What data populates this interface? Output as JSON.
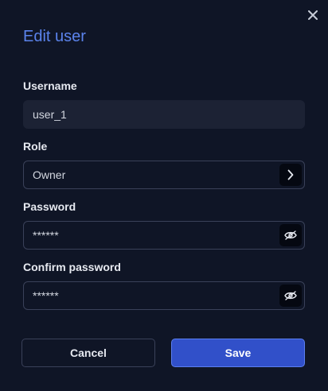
{
  "dialog": {
    "title": "Edit user",
    "close_icon": "close-icon"
  },
  "form": {
    "username": {
      "label": "Username",
      "value": "user_1"
    },
    "role": {
      "label": "Role",
      "value": "Owner",
      "icon": "chevron-right-icon"
    },
    "password": {
      "label": "Password",
      "value": "******",
      "icon": "eye-slash-icon"
    },
    "confirm_password": {
      "label": "Confirm password",
      "value": "******",
      "icon": "eye-slash-icon"
    }
  },
  "actions": {
    "cancel_label": "Cancel",
    "save_label": "Save"
  },
  "colors": {
    "background": "#0f1526",
    "accent": "#5b83ec",
    "primary_button": "#3150c9",
    "input_fill": "#1c2234",
    "border": "#3a4159"
  }
}
